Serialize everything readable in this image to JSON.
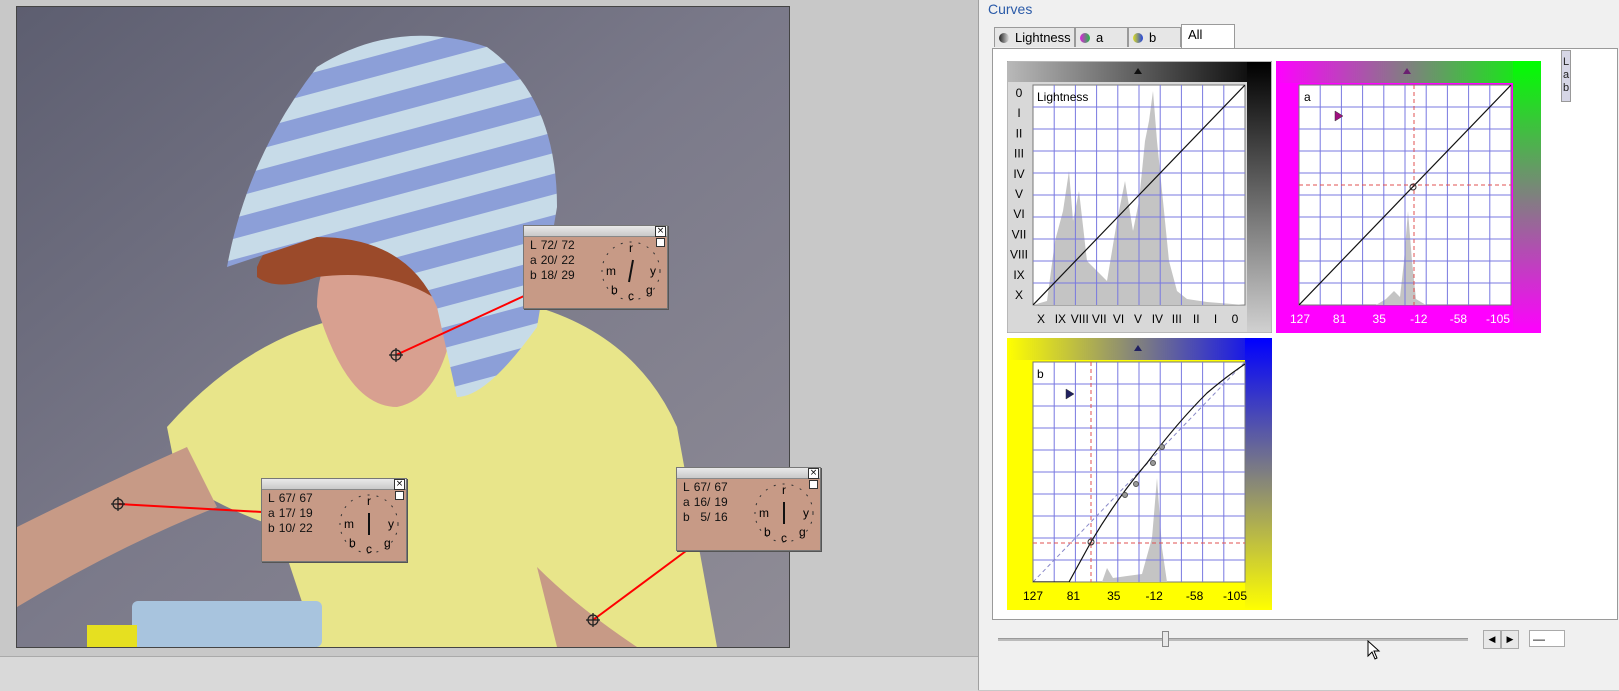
{
  "panel": {
    "title": "Curves",
    "tabs": [
      {
        "label": "Lightness",
        "icon": "lightness-icon"
      },
      {
        "label": "a",
        "icon": "a-channel-icon"
      },
      {
        "label": "b",
        "icon": "b-channel-icon"
      },
      {
        "label": "All",
        "active": true
      }
    ],
    "side_letters": [
      "L",
      "a",
      "b"
    ],
    "value_box": "—"
  },
  "samplers": [
    {
      "rows": [
        {
          "ch": "L",
          "v1": "72/",
          "v2": "72"
        },
        {
          "ch": "a",
          "v1": "20/",
          "v2": "22"
        },
        {
          "ch": "b",
          "v1": "18/",
          "v2": "29"
        }
      ],
      "dial": {
        "top": "r",
        "left": "m",
        "right": "y",
        "bl": "b",
        "br": "g",
        "bottom": "c"
      }
    },
    {
      "rows": [
        {
          "ch": "L",
          "v1": "67/",
          "v2": "67"
        },
        {
          "ch": "a",
          "v1": "17/",
          "v2": "19"
        },
        {
          "ch": "b",
          "v1": "10/",
          "v2": "22"
        }
      ],
      "dial": {
        "top": "r",
        "left": "m",
        "right": "y",
        "bl": "b",
        "br": "g",
        "bottom": "c"
      }
    },
    {
      "rows": [
        {
          "ch": "L",
          "v1": "67/",
          "v2": "67"
        },
        {
          "ch": "a",
          "v1": "16/",
          "v2": "19"
        },
        {
          "ch": "b",
          "v1": "5/",
          "v2": "16"
        }
      ],
      "dial": {
        "top": "r",
        "left": "m",
        "right": "y",
        "bl": "b",
        "br": "g",
        "bottom": "c"
      }
    }
  ],
  "curves": {
    "lightness": {
      "name": "Lightness",
      "y_labels": [
        "0",
        "I",
        "II",
        "III",
        "IV",
        "V",
        "VI",
        "VII",
        "VIII",
        "IX",
        "X"
      ],
      "x_labels": [
        "X",
        "IX",
        "VIII",
        "VII",
        "VI",
        "V",
        "IV",
        "III",
        "II",
        "I",
        "0"
      ]
    },
    "a": {
      "name": "a",
      "x_labels": [
        "127",
        "81",
        "35",
        "-12",
        "-58",
        "-105"
      ]
    },
    "b": {
      "name": "b",
      "x_labels": [
        "127",
        "81",
        "35",
        "-12",
        "-58",
        "-105"
      ]
    }
  },
  "colors": {
    "grid": "#7878e0",
    "panel_title": "#2a5aa8",
    "sampler_bg": "#c79a86",
    "magenta": "#ff00ff",
    "green": "#00ff00",
    "yellow": "#ffff00",
    "blue": "#0000ff",
    "sampler_line": "#ff0000"
  }
}
